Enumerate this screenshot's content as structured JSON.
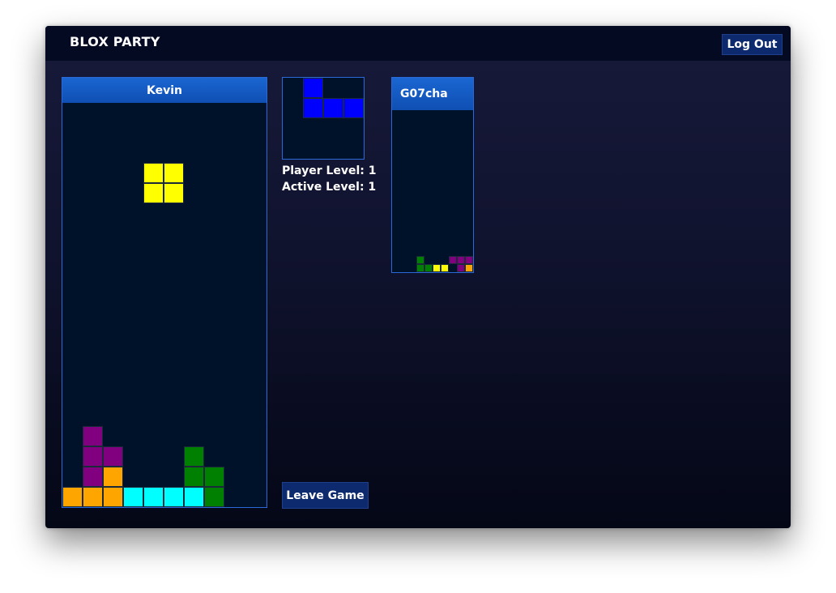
{
  "app": {
    "title": "BLOX PARTY",
    "logout_label": "Log Out"
  },
  "colors": {
    "cyan": "#00ffff",
    "blue": "#0000ff",
    "orange": "#ffa500",
    "yellow": "#ffff00",
    "green": "#008000",
    "purple": "#800080"
  },
  "player_board": {
    "name": "Kevin",
    "columns": 10,
    "rows": 20,
    "active_piece": {
      "color": "yellow",
      "cells": [
        [
          4,
          3
        ],
        [
          5,
          3
        ],
        [
          4,
          4
        ],
        [
          5,
          4
        ]
      ]
    },
    "settled_cells": [
      {
        "col": 1,
        "row": 16,
        "color": "purple"
      },
      {
        "col": 1,
        "row": 17,
        "color": "purple"
      },
      {
        "col": 2,
        "row": 17,
        "color": "purple"
      },
      {
        "col": 6,
        "row": 17,
        "color": "green"
      },
      {
        "col": 1,
        "row": 18,
        "color": "purple"
      },
      {
        "col": 2,
        "row": 18,
        "color": "orange"
      },
      {
        "col": 6,
        "row": 18,
        "color": "green"
      },
      {
        "col": 7,
        "row": 18,
        "color": "green"
      },
      {
        "col": 0,
        "row": 19,
        "color": "orange"
      },
      {
        "col": 1,
        "row": 19,
        "color": "orange"
      },
      {
        "col": 2,
        "row": 19,
        "color": "orange"
      },
      {
        "col": 3,
        "row": 19,
        "color": "cyan"
      },
      {
        "col": 4,
        "row": 19,
        "color": "cyan"
      },
      {
        "col": 5,
        "row": 19,
        "color": "cyan"
      },
      {
        "col": 6,
        "row": 19,
        "color": "cyan"
      },
      {
        "col": 7,
        "row": 19,
        "color": "green"
      }
    ]
  },
  "next_piece": {
    "color": "blue",
    "cells": [
      [
        1,
        0
      ],
      [
        1,
        1
      ],
      [
        2,
        1
      ],
      [
        3,
        1
      ]
    ]
  },
  "stats": {
    "player_level": "Player Level: 1",
    "active_level": "Active Level: 1"
  },
  "leave_label": "Leave Game",
  "opponent_board": {
    "name": "G07cha",
    "columns": 10,
    "rows": 20,
    "settled_cells": [
      {
        "col": 3,
        "row": 18,
        "color": "green"
      },
      {
        "col": 7,
        "row": 18,
        "color": "purple"
      },
      {
        "col": 8,
        "row": 18,
        "color": "purple"
      },
      {
        "col": 9,
        "row": 18,
        "color": "purple"
      },
      {
        "col": 3,
        "row": 19,
        "color": "green"
      },
      {
        "col": 4,
        "row": 19,
        "color": "green"
      },
      {
        "col": 5,
        "row": 19,
        "color": "yellow"
      },
      {
        "col": 6,
        "row": 19,
        "color": "yellow"
      },
      {
        "col": 8,
        "row": 19,
        "color": "purple"
      },
      {
        "col": 9,
        "row": 19,
        "color": "orange"
      }
    ]
  }
}
